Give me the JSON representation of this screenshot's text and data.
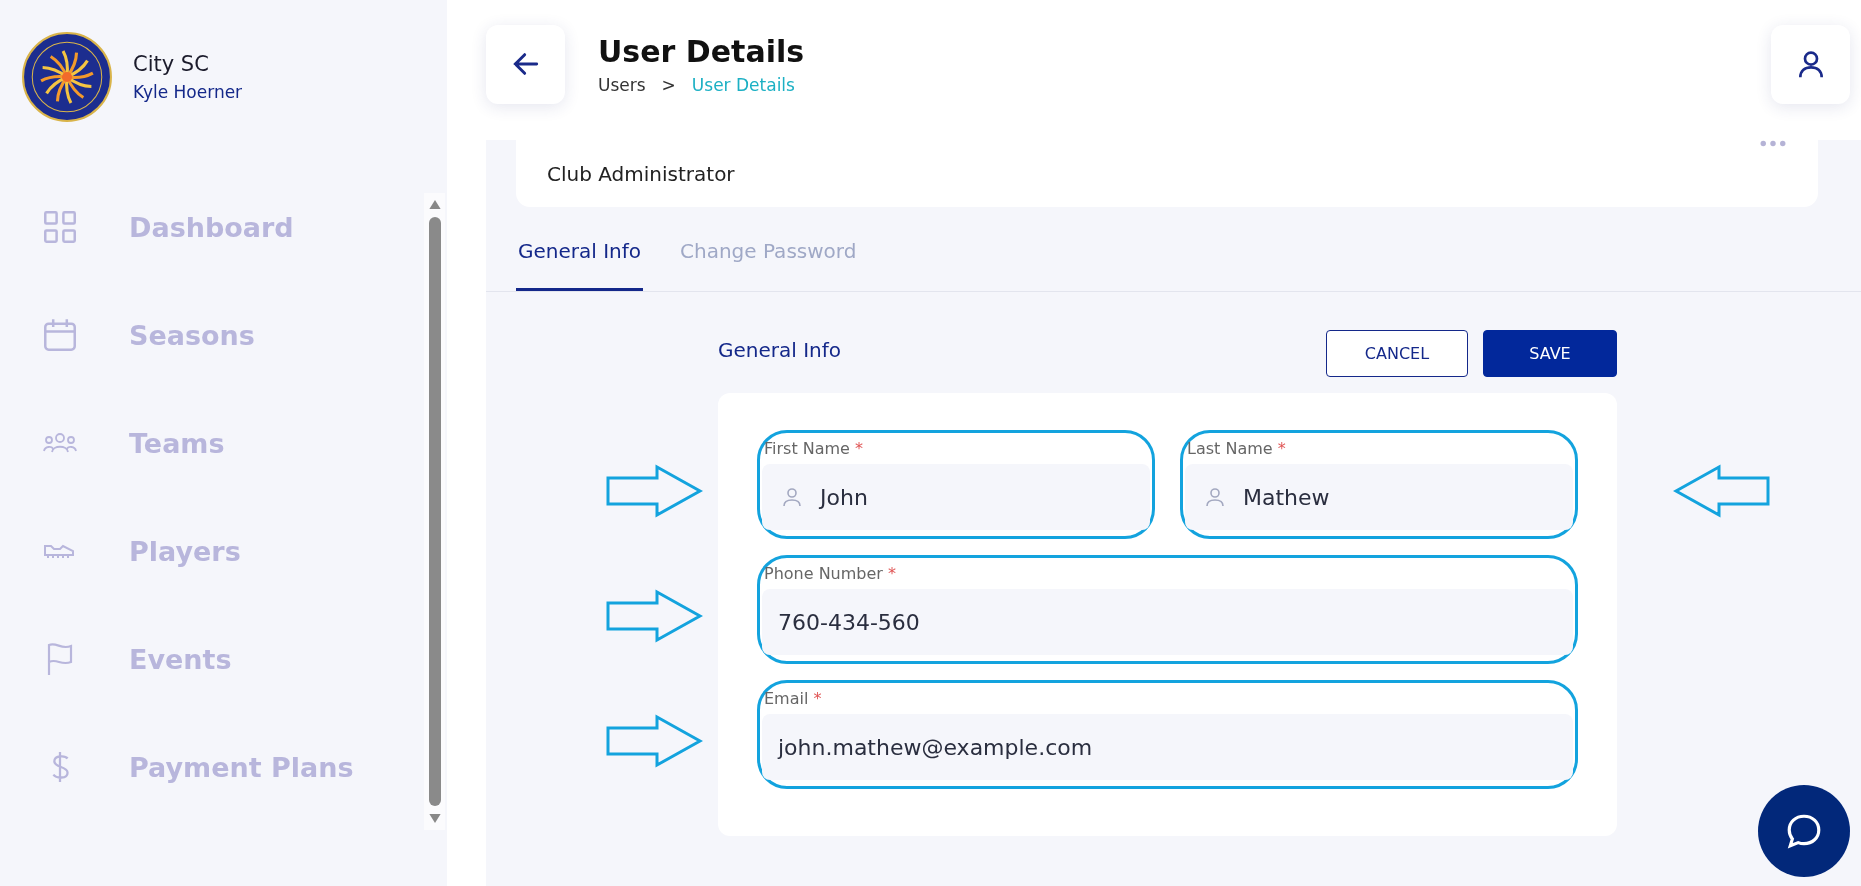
{
  "sidebar": {
    "club_name": "City SC",
    "user_name": "Kyle Hoerner",
    "items": [
      {
        "label": "Dashboard",
        "selected": false
      },
      {
        "label": "Seasons",
        "selected": false
      },
      {
        "label": "Teams",
        "selected": false
      },
      {
        "label": "Players",
        "selected": false
      },
      {
        "label": "Events",
        "selected": false
      },
      {
        "label": "Payment Plans",
        "selected": false
      }
    ]
  },
  "header": {
    "title": "User Details",
    "breadcrumb": [
      {
        "label": "Users",
        "current": false
      },
      {
        "label": "User Details",
        "current": true
      }
    ],
    "separator": ">"
  },
  "role_card": {
    "role": "Club Administrator"
  },
  "tabs": [
    {
      "label": "General Info",
      "selected": true
    },
    {
      "label": "Change Password",
      "selected": false
    }
  ],
  "form": {
    "title": "General Info",
    "buttons": [
      {
        "label": "CANCEL",
        "kind": "secondary"
      },
      {
        "label": "SAVE",
        "kind": "primary"
      }
    ],
    "fields": [
      {
        "kind": "name",
        "label": "First Name",
        "required_mark": "*",
        "value": "John",
        "annotated": true,
        "arrow": true,
        "arrow_mirrored": false
      },
      {
        "kind": "name",
        "label": "Last Name",
        "required_mark": "*",
        "value": "Mathew",
        "annotated": true,
        "arrow": true,
        "arrow_mirrored": true
      },
      {
        "kind": "text",
        "label": "Phone Number",
        "required_mark": "*",
        "value": "760-434-560",
        "annotated": true,
        "arrow": true,
        "arrow_mirrored": false
      },
      {
        "kind": "text",
        "label": "Email",
        "required_mark": "*",
        "value": "john.mathew@example.com",
        "annotated": true,
        "arrow": true,
        "arrow_mirrored": false
      }
    ]
  }
}
